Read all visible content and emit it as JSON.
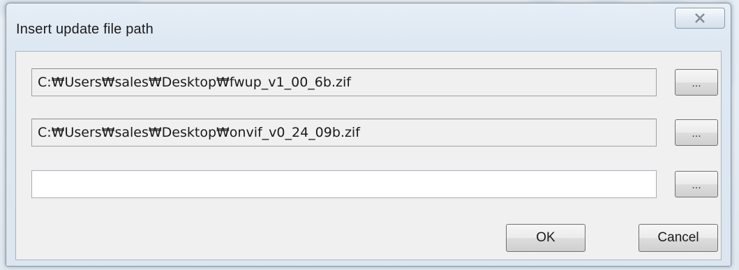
{
  "dialog": {
    "title": "Insert update file path",
    "close_icon": "close-x-icon"
  },
  "fields": [
    {
      "value": "C:₩Users₩sales₩Desktop₩fwup_v1_00_6b.zif",
      "browse_label": "..."
    },
    {
      "value": "C:₩Users₩sales₩Desktop₩onvif_v0_24_09b.zif",
      "browse_label": "..."
    },
    {
      "value": "",
      "browse_label": "..."
    }
  ],
  "buttons": {
    "ok_label": "OK",
    "cancel_label": "Cancel"
  }
}
